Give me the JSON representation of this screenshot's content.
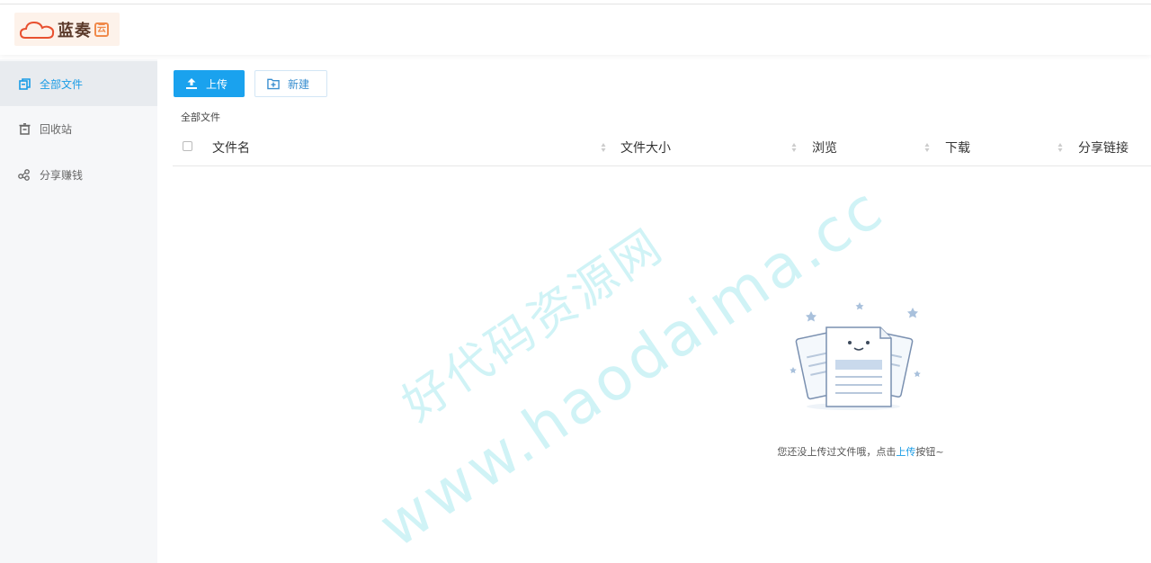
{
  "app": {
    "logo_text": "蓝奏",
    "logo_badge": "云"
  },
  "sidebar": {
    "items": [
      {
        "label": "全部文件",
        "icon": "files-icon",
        "active": true
      },
      {
        "label": "回收站",
        "icon": "trash-icon",
        "active": false
      },
      {
        "label": "分享赚钱",
        "icon": "share-icon",
        "active": false
      }
    ]
  },
  "toolbar": {
    "upload_label": "上传",
    "new_label": "新建"
  },
  "breadcrumb": "全部文件",
  "table": {
    "columns": [
      "文件名",
      "文件大小",
      "浏览",
      "下载",
      "分享链接"
    ]
  },
  "empty": {
    "text_before": "您还没上传过文件哦，点击",
    "link": "上传",
    "text_after": "按钮~"
  },
  "watermark": {
    "line1": "好代码资源网",
    "line2": "www.haodaima.cc"
  },
  "colors": {
    "accent": "#1aa2ee",
    "active_text": "#1a9ce6"
  }
}
